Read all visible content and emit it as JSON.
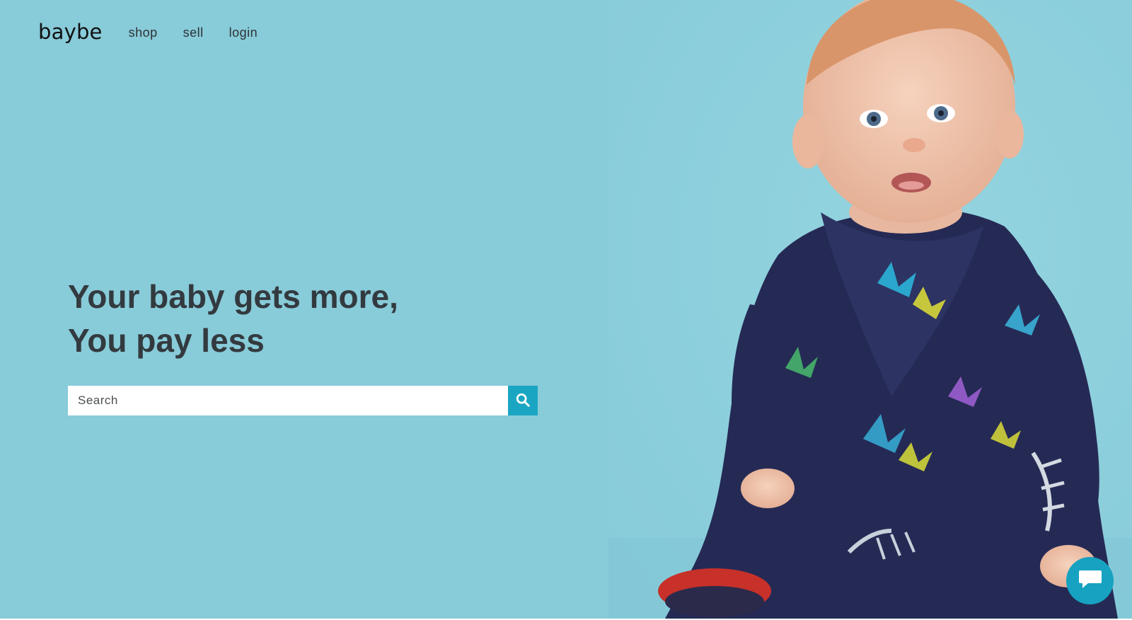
{
  "nav": {
    "brand": "baybe",
    "links": [
      "shop",
      "sell",
      "login"
    ]
  },
  "hero": {
    "headline_line1": "Your baby gets more,",
    "headline_line2": "You pay less",
    "image_subject": "baby in floral onesie"
  },
  "search": {
    "placeholder": "Search",
    "value": "",
    "icon": "search-icon"
  },
  "chat": {
    "icon": "chat-bubble-icon"
  },
  "colors": {
    "background": "#88cbd9",
    "accent": "#1aa6c2",
    "text": "#333a3f"
  }
}
